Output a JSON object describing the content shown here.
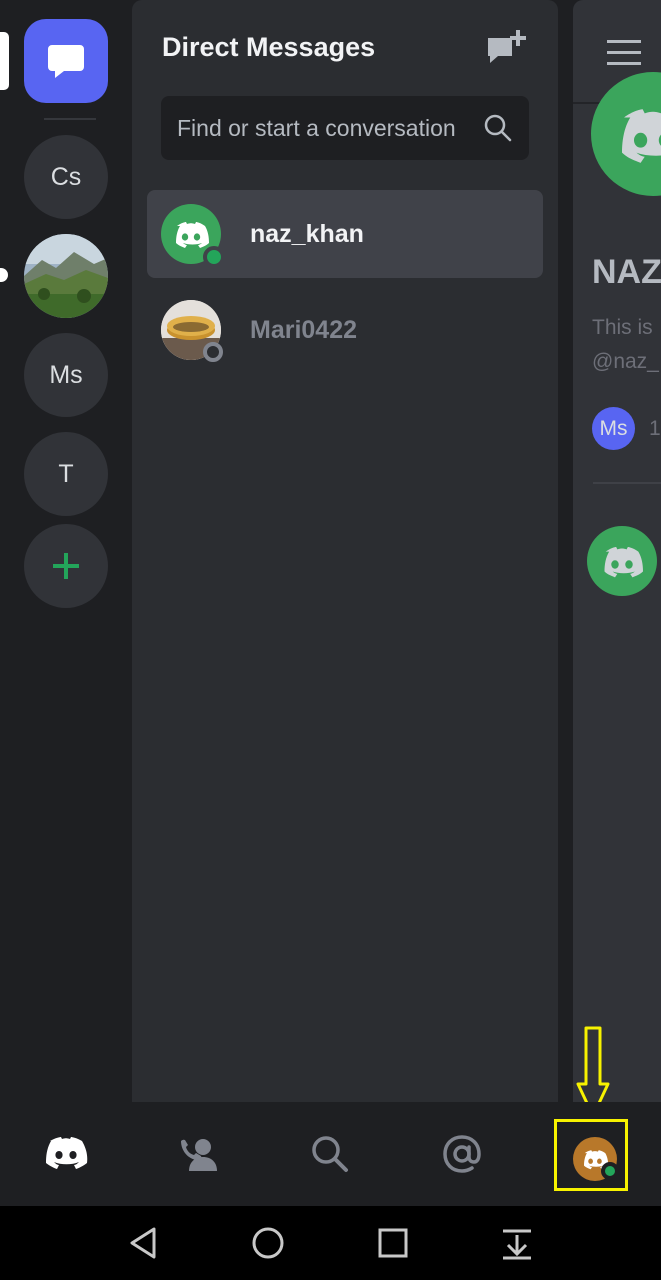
{
  "rail": {
    "guilds": [
      {
        "label": "",
        "kind": "dm-home"
      },
      {
        "label": "Cs"
      },
      {
        "label": "",
        "kind": "image"
      },
      {
        "label": "Ms"
      },
      {
        "label": "T"
      },
      {
        "label": "+",
        "kind": "add-server"
      }
    ]
  },
  "dm_panel": {
    "title": "Direct Messages",
    "search_placeholder": "Find or start a conversation",
    "conversations": [
      {
        "name": "naz_khan",
        "status": "online",
        "active": true
      },
      {
        "name": "Mari0422",
        "status": "offline",
        "active": false
      }
    ]
  },
  "chat": {
    "name": "NAZ",
    "line1": "This is",
    "line2": "@naz_",
    "mutual_label": "Ms",
    "mutual_count": "1"
  },
  "tabs": [
    {
      "name": "home",
      "icon": "discord-icon"
    },
    {
      "name": "friends",
      "icon": "friends-icon"
    },
    {
      "name": "search",
      "icon": "search-icon"
    },
    {
      "name": "mentions",
      "icon": "at-icon"
    },
    {
      "name": "you",
      "icon": "avatar"
    }
  ],
  "colors": {
    "blurple": "#5865f2",
    "green": "#23a55a",
    "annotation": "#f7f200"
  }
}
